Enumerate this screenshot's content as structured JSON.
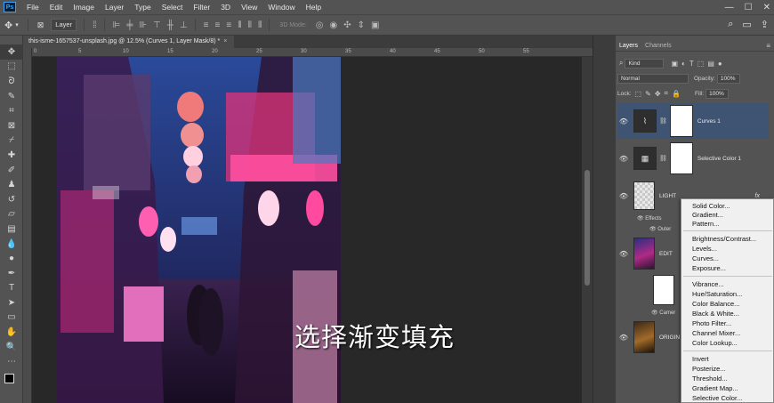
{
  "app": {
    "logo": "Ps"
  },
  "menubar": {
    "items": [
      "File",
      "Edit",
      "Image",
      "Layer",
      "Type",
      "Select",
      "Filter",
      "3D",
      "View",
      "Window",
      "Help"
    ]
  },
  "options": {
    "layer_select": "Layer",
    "mode_3d": "3D Mode:"
  },
  "document": {
    "tab_title": "this-isme-1657537-unsplash.jpg @ 12.5% (Curves 1, Layer Mask/8) *"
  },
  "ruler": {
    "ticks": [
      "0",
      "5",
      "10",
      "15",
      "20",
      "25",
      "30",
      "35",
      "40",
      "45",
      "50",
      "55"
    ]
  },
  "subtitle": "选择渐变填充",
  "layers_panel": {
    "tabs": [
      "Layers",
      "Channels"
    ],
    "kind_label": "Kind",
    "blend_mode": "Normal",
    "opacity_label": "Opacity:",
    "opacity_value": "100%",
    "lock_label": "Lock:",
    "fill_label": "Fill:",
    "fill_value": "100%",
    "layers": [
      {
        "name": "Curves 1"
      },
      {
        "name": "Selective Color 1"
      },
      {
        "name": "LIGHT"
      },
      {
        "name": "EDIT"
      },
      {
        "name": "ORIGIN"
      }
    ],
    "effects_label": "Effects",
    "outer_label": "Outer",
    "camera_label": "Camer",
    "fx_label": "fx"
  },
  "adjustment_menu": {
    "group1": [
      "Solid Color...",
      "Gradient...",
      "Pattern..."
    ],
    "group2": [
      "Brightness/Contrast...",
      "Levels...",
      "Curves...",
      "Exposure..."
    ],
    "group3": [
      "Vibrance...",
      "Hue/Saturation...",
      "Color Balance...",
      "Black & White...",
      "Photo Filter...",
      "Channel Mixer...",
      "Color Lookup..."
    ],
    "group4": [
      "Invert",
      "Posterize...",
      "Threshold...",
      "Gradient Map...",
      "Selective Color..."
    ]
  }
}
